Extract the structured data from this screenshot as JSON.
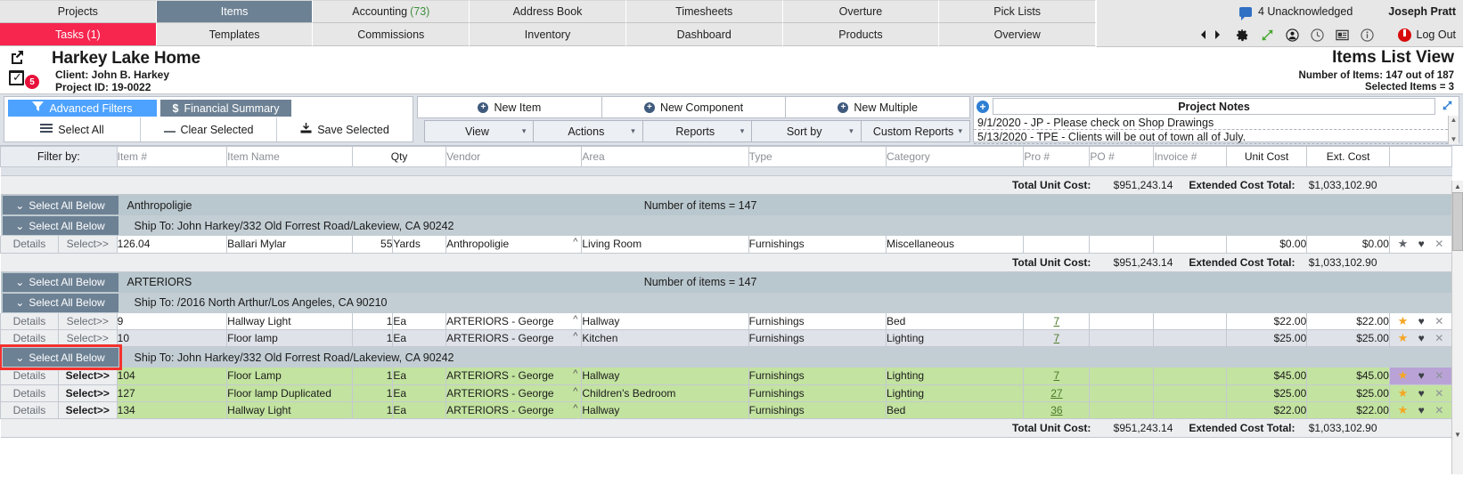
{
  "nav": {
    "row1": [
      {
        "label": "Projects",
        "state": "normal"
      },
      {
        "label": "Items",
        "state": "active"
      },
      {
        "label": "Accounting",
        "count": "(73)",
        "state": "normal"
      },
      {
        "label": "Address Book",
        "state": "normal"
      },
      {
        "label": "Timesheets",
        "state": "normal"
      },
      {
        "label": "Overture",
        "state": "normal"
      },
      {
        "label": "Pick Lists",
        "state": "normal"
      }
    ],
    "row2": [
      {
        "label": "Tasks (1)",
        "state": "tasks"
      },
      {
        "label": "Templates",
        "state": "normal"
      },
      {
        "label": "Commissions",
        "state": "normal"
      },
      {
        "label": "Inventory",
        "state": "normal"
      },
      {
        "label": "Dashboard",
        "state": "normal"
      },
      {
        "label": "Products",
        "state": "normal"
      },
      {
        "label": "Overview",
        "state": "normal"
      }
    ],
    "unacknowledged": "4 Unacknowledged",
    "user": "Joseph Pratt",
    "logout": "Log Out",
    "icons": [
      "prev-arrow-icon",
      "next-arrow-icon",
      "gear-icon",
      "expand-arrows-icon",
      "user-icon",
      "clock-icon",
      "card-icon",
      "info-icon"
    ]
  },
  "project": {
    "title": "Harkey Lake Home",
    "client": "Client: John B. Harkey",
    "project_id": "Project ID: 19-0022",
    "task_badge": "5",
    "view_title": "Items List View",
    "item_count": "Number of Items: 147 out of 187",
    "selected_items": "Selected Items = 3"
  },
  "toolbar": {
    "advanced_filters": "Advanced Filters",
    "financial_summary": "Financial Summary",
    "select_all": "Select All",
    "clear_selected": "Clear Selected",
    "save_selected": "Save Selected",
    "new_item": "New Item",
    "new_component": "New Component",
    "new_multiple": "New Multiple",
    "dropdowns": [
      "View",
      "Actions",
      "Reports",
      "Sort by",
      "Custom Reports"
    ]
  },
  "notes": {
    "title": "Project Notes",
    "lines": [
      "9/1/2020 - JP - Please check on Shop Drawings",
      "5/13/2020 - TPE - Clients will be out of town all of July."
    ]
  },
  "filter_row": {
    "label": "Filter by:",
    "columns": [
      "Item #",
      "Item Name",
      "Qty",
      "Vendor",
      "Area",
      "Type",
      "Category",
      "Pro #",
      "PO #",
      "Invoice #",
      "Unit Cost",
      "Ext. Cost"
    ]
  },
  "totals": {
    "unit_label": "Total Unit Cost:",
    "unit_value": "$951,243.14",
    "ext_label": "Extended Cost Total:",
    "ext_value": "$1,033,102.90"
  },
  "grid": {
    "select_all_below": "Select All Below",
    "details": "Details",
    "select": "Select>>",
    "sections": [
      {
        "vendor": "Anthropoligie",
        "count": "Number of items = 147",
        "ship_to": "Ship To: John Harkey/332 Old Forrest Road/Lakeview, CA 90242",
        "rows": [
          {
            "item_no": "126.04",
            "name": "Ballari Mylar",
            "qty": "55",
            "unit": "Yards",
            "vendor": "Anthropoligie",
            "area": "Living Room",
            "type": "Furnishings",
            "category": "Miscellaneous",
            "pro": "",
            "po": "",
            "invoice": "",
            "unit_cost": "$0.00",
            "ext_cost": "$0.00",
            "selected": false,
            "alt": false,
            "star": "grey",
            "purple": false
          }
        ]
      },
      {
        "vendor": "ARTERIORS",
        "count": "Number of items = 147",
        "ship_to": "Ship To: /2016 North Arthur/Los Angeles, CA 90210",
        "rows": [
          {
            "item_no": "9",
            "name": "Hallway Light",
            "qty": "1",
            "unit": "Ea",
            "vendor": "ARTERIORS - George",
            "area": "Hallway",
            "type": "Furnishings",
            "category": "Bed",
            "pro": "7",
            "po": "",
            "invoice": "",
            "unit_cost": "$22.00",
            "ext_cost": "$22.00",
            "selected": false,
            "alt": false,
            "star": "gold",
            "purple": false
          },
          {
            "item_no": "10",
            "name": "Floor lamp",
            "qty": "1",
            "unit": "Ea",
            "vendor": "ARTERIORS - George",
            "area": "Kitchen",
            "type": "Furnishings",
            "category": "Lighting",
            "pro": "7",
            "po": "",
            "invoice": "",
            "unit_cost": "$25.00",
            "ext_cost": "$25.00",
            "selected": false,
            "alt": true,
            "star": "gold",
            "purple": false
          }
        ]
      }
    ],
    "highlighted_section": {
      "ship_to": "Ship To: John Harkey/332 Old Forrest Road/Lakeview, CA 90242",
      "rows": [
        {
          "item_no": "104",
          "name": "Floor Lamp",
          "qty": "1",
          "unit": "Ea",
          "vendor": "ARTERIORS - George",
          "area": "Hallway",
          "type": "Furnishings",
          "category": "Lighting",
          "pro": "7",
          "po": "",
          "invoice": "",
          "unit_cost": "$45.00",
          "ext_cost": "$45.00",
          "selected": true,
          "alt": false,
          "star": "gold",
          "purple": true
        },
        {
          "item_no": "127",
          "name": "Floor lamp Duplicated",
          "qty": "1",
          "unit": "Ea",
          "vendor": "ARTERIORS - George",
          "area": "Children's Bedroom",
          "type": "Furnishings",
          "category": "Lighting",
          "pro": "27",
          "po": "",
          "invoice": "",
          "unit_cost": "$25.00",
          "ext_cost": "$25.00",
          "selected": true,
          "alt": false,
          "star": "gold",
          "purple": false
        },
        {
          "item_no": "134",
          "name": "Hallway Light",
          "qty": "1",
          "unit": "Ea",
          "vendor": "ARTERIORS - George",
          "area": "Hallway",
          "type": "Furnishings",
          "category": "Bed",
          "pro": "36",
          "po": "",
          "invoice": "",
          "unit_cost": "$22.00",
          "ext_cost": "$22.00",
          "selected": true,
          "alt": false,
          "star": "gold",
          "purple": false
        }
      ]
    }
  },
  "colors": {
    "accent_blue": "#4da2ff",
    "slate": "#6d8194",
    "tasks_red": "#f6264f",
    "selected_green": "#c3e3a0",
    "highlight_red": "#f4312e",
    "purple": "#b9a3d6",
    "gold": "#f5a623",
    "link_green": "#4c7a28"
  }
}
